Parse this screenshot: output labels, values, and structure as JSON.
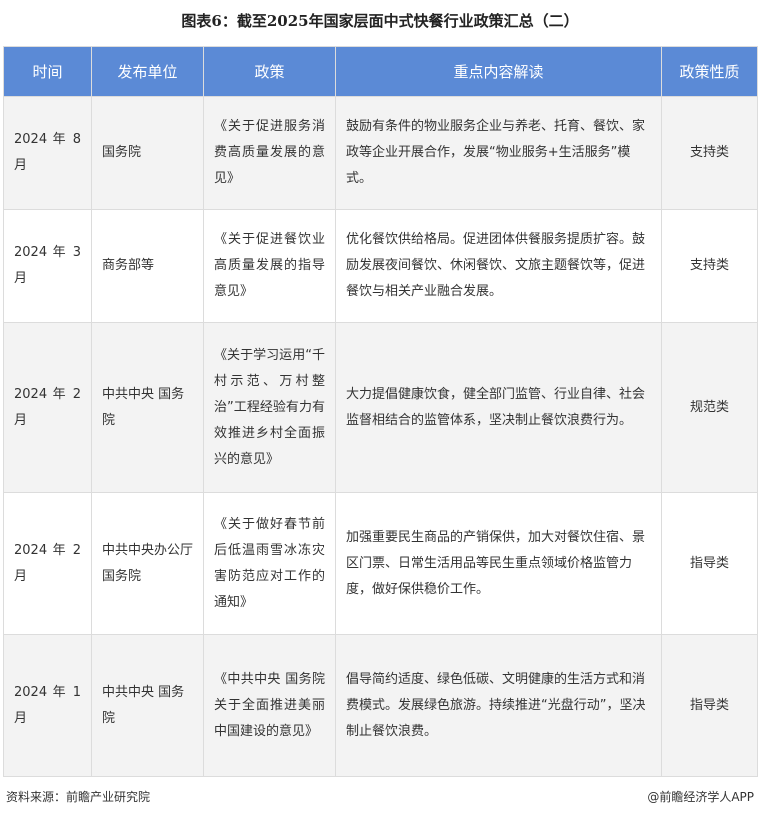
{
  "title": "图表6：截至2025年国家层面中式快餐行业政策汇总（二）",
  "table": {
    "headers": [
      "时间",
      "发布单位",
      "政策",
      "重点内容解读",
      "政策性质"
    ],
    "rows": [
      {
        "time": "2024 年 8 月",
        "issuer": "国务院",
        "policy": "《关于促进服务消费高质量发展的意见》",
        "content": "鼓励有条件的物业服务企业与养老、托育、餐饮、家政等企业开展合作，发展“物业服务+生活服务”模式。",
        "nature": "支持类"
      },
      {
        "time": "2024 年 3 月",
        "issuer": "商务部等",
        "policy": "《关于促进餐饮业高质量发展的指导意见》",
        "content": "优化餐饮供给格局。促进团体供餐服务提质扩容。鼓励发展夜间餐饮、休闲餐饮、文旅主题餐饮等，促进餐饮与相关产业融合发展。",
        "nature": "支持类"
      },
      {
        "time": "2024 年 2 月",
        "issuer": "中共中央 国务院",
        "policy": "《关于学习运用“千村示范、万村整治”工程经验有力有效推进乡村全面振兴的意见》",
        "content": "大力提倡健康饮食，健全部门监管、行业自律、社会监督相结合的监管体系，坚决制止餐饮浪费行为。",
        "nature": "规范类"
      },
      {
        "time": "2024 年 2 月",
        "issuer": "中共中央办公厅 国务院",
        "policy": "《关于做好春节前后低温雨雪冰冻灾害防范应对工作的通知》",
        "content": "加强重要民生商品的产销保供，加大对餐饮住宿、景区门票、日常生活用品等民生重点领域价格监管力度，做好保供稳价工作。",
        "nature": "指导类"
      },
      {
        "time": "2024 年 1 月",
        "issuer": "中共中央 国务院",
        "policy": "《中共中央 国务院关于全面推进美丽中国建设的意见》",
        "content": "倡导简约适度、绿色低碳、文明健康的生活方式和消费模式。发展绿色旅游。持续推进“光盘行动”，坚决制止餐饮浪费。",
        "nature": "指导类"
      }
    ]
  },
  "footer": {
    "source": "资料来源：前瞻产业研究院",
    "brand": "@前瞻经济学人APP"
  }
}
